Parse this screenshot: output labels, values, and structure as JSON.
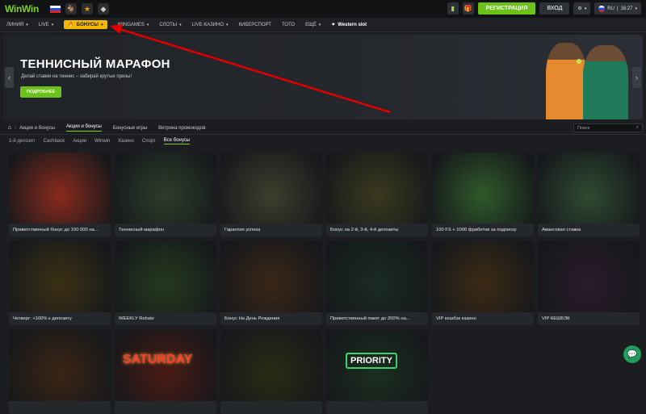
{
  "brand": {
    "logo_a": "Win",
    "logo_b": "Win"
  },
  "header": {
    "register_label": "РЕГИСТРАЦИЯ",
    "login_label": "ВХОД",
    "lang_label": "RU",
    "time": "16:27"
  },
  "nav": {
    "items": [
      {
        "label": "ЛИНИЯ",
        "chevron": true
      },
      {
        "label": "LIVE",
        "chevron": true
      },
      {
        "label": "БОНУСЫ",
        "chevron": true
      },
      {
        "label": "WINGAMES",
        "chevron": true
      },
      {
        "label": "СЛОТЫ",
        "chevron": true
      },
      {
        "label": "LIVE-КАЗИНО",
        "chevron": true
      },
      {
        "label": "КИБЕРСПОРТ",
        "chevron": false
      },
      {
        "label": "ТОТО",
        "chevron": false
      },
      {
        "label": "ЕЩЁ",
        "chevron": true
      },
      {
        "label": "Western slot",
        "chevron": false
      }
    ]
  },
  "hero": {
    "title": "ТЕННИСНЫЙ МАРАФОН",
    "subtitle": "Делай ставки на теннис – забирай крутые призы!",
    "button": "ПОДРОБНЕЕ"
  },
  "subnav": {
    "breadcrumb": "Акции и бонусы",
    "tabs": [
      "Акции и бонусы",
      "Бонусные игры",
      "Витрина промокодов"
    ],
    "search_placeholder": "Поиск"
  },
  "filters": [
    "1-й депозит",
    "Cashback",
    "Акции",
    "Winwin",
    "Казино",
    "Спорт",
    "Все бонусы"
  ],
  "cards": [
    {
      "label": "Приветственный бонус до 100 000 на...",
      "bg": "#8a2a1c"
    },
    {
      "label": "Теннисный марафон",
      "bg": "#2c3d2a"
    },
    {
      "label": "Гарантия успеха",
      "bg": "#3a3f2c"
    },
    {
      "label": "Бонус на 2-й, 3-й, 4-й депозиты",
      "bg": "#3a3a1e"
    },
    {
      "label": "100 FS + 1000 фрибетов за подписку",
      "bg": "#2e5a2a"
    },
    {
      "label": "Авансовая ставка",
      "bg": "#2f4a32"
    },
    {
      "label": "Четверг: +100% к депозиту",
      "bg": "#3b3014"
    },
    {
      "label": "WEEKLY Rebate",
      "bg": "#243a1e"
    },
    {
      "label": "Бонус На День Рождения",
      "bg": "#3a2616"
    },
    {
      "label": "Приветственный пакет до 200% на...",
      "bg": "#1a2a24"
    },
    {
      "label": "VIP кешбэк казино",
      "bg": "#3b2a14"
    },
    {
      "label": "VIP КЕШБЭК",
      "bg": "#2a1a2a"
    },
    {
      "label": "",
      "bg": "#3a2414"
    },
    {
      "label": "",
      "bg": "#4a1a14"
    },
    {
      "label": "",
      "bg": "#2a2a14"
    },
    {
      "label": "",
      "bg": "#1a2e20"
    }
  ],
  "card_art": [
    "SATURDAY",
    "PRIORITY"
  ]
}
